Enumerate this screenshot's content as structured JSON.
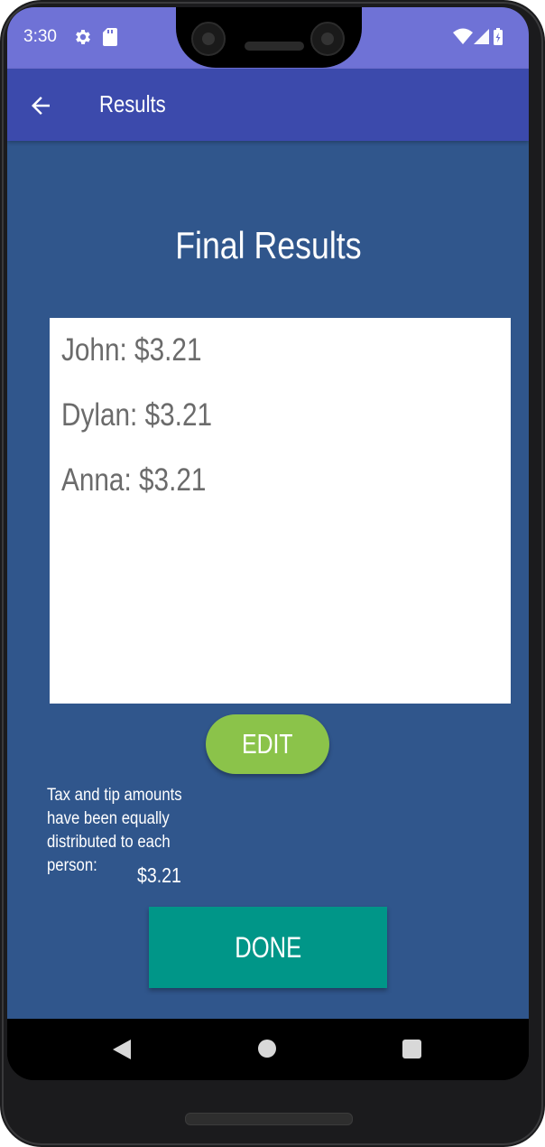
{
  "status_bar": {
    "time": "3:30",
    "icons": [
      "gear-icon",
      "sd-card-icon",
      "wifi-icon",
      "signal-icon",
      "battery-icon"
    ]
  },
  "app_bar": {
    "title": "Results",
    "back_icon": "arrow-back-icon"
  },
  "main": {
    "heading": "Final Results",
    "results": [
      "John: $3.21",
      "Dylan: $3.21",
      "Anna: $3.21"
    ],
    "edit_label": "EDIT",
    "tax_note": "Tax and tip amounts have been equally distributed to each person:",
    "tax_amount": "$3.21",
    "done_label": "DONE"
  },
  "nav_bar": {
    "icons": [
      "nav-back-icon",
      "nav-home-icon",
      "nav-recents-icon"
    ]
  },
  "colors": {
    "status_bar": "#6f72d6",
    "app_bar": "#3c4aac",
    "background": "#30568c",
    "edit_button": "#8bc34a",
    "done_button": "#009688",
    "result_text": "#6b6b6b"
  }
}
